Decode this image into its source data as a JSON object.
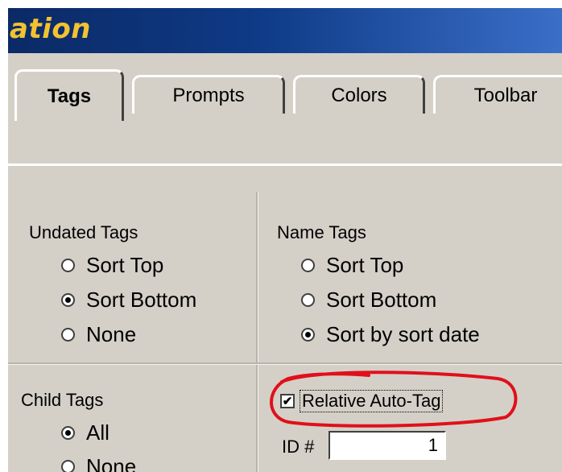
{
  "window": {
    "title": "ation"
  },
  "tabs": [
    {
      "label": "Tags",
      "active": true
    },
    {
      "label": "Prompts",
      "active": false
    },
    {
      "label": "Colors",
      "active": false
    },
    {
      "label": "Toolbar",
      "active": false
    }
  ],
  "undated_tags": {
    "label": "Undated Tags",
    "options": [
      "Sort Top",
      "Sort Bottom",
      "None"
    ],
    "selected": "Sort Bottom"
  },
  "name_tags": {
    "label": "Name Tags",
    "options": [
      "Sort Top",
      "Sort Bottom",
      "Sort by sort date"
    ],
    "selected": "Sort by sort date"
  },
  "child_tags": {
    "label": "Child Tags",
    "options": [
      "All",
      "None"
    ],
    "selected": "All"
  },
  "relative_auto_tag": {
    "label": "Relative Auto-Tag",
    "checked": true
  },
  "id_field": {
    "label": "ID #",
    "value": "1"
  },
  "colors": {
    "title_text": "#f2c230",
    "annotation": "#e0101a"
  }
}
